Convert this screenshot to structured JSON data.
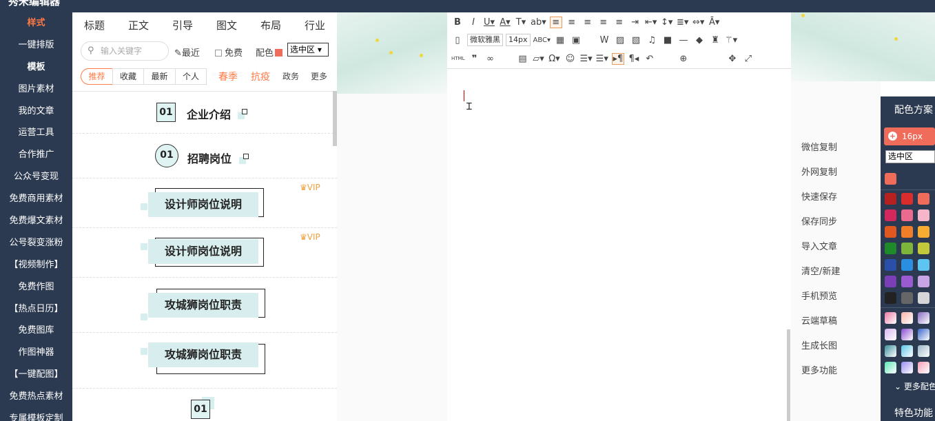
{
  "app": {
    "logo": "秀米编辑器"
  },
  "sidebar": {
    "items": [
      "样式",
      "一键排版",
      "模板",
      "图片素材",
      "我的文章",
      "运营工具",
      "合作推广",
      "公众号变现",
      "免费商用素材",
      "免费爆文素材",
      "公号裂变涨粉",
      "【视频制作】",
      "免费作图",
      "【热点日历】",
      "免费图库",
      "作图神器",
      "【一键配图】",
      "免费热点素材",
      "专属模板定制"
    ]
  },
  "panel": {
    "categories": [
      "标题",
      "正文",
      "引导",
      "图文",
      "布局",
      "行业"
    ],
    "search": {
      "placeholder": "输入关键字"
    },
    "recent": "最近",
    "free": "免费",
    "color_label": "配色",
    "color_select": "选中区 ▾",
    "filters": [
      "推荐",
      "收藏",
      "最新",
      "个人"
    ],
    "tags_hot": [
      "春季",
      "抗疫"
    ],
    "tags": [
      "政务",
      "更多"
    ],
    "templates": [
      {
        "num": "01",
        "title": "企业介绍"
      },
      {
        "num": "01",
        "title": "招聘岗位"
      },
      {
        "title": "设计师岗位说明",
        "badge": "VIP"
      },
      {
        "title": "设计师岗位说明",
        "badge": "VIP"
      },
      {
        "title": "攻城狮岗位职责"
      },
      {
        "title": "攻城狮岗位职责"
      },
      {
        "num": "01"
      }
    ]
  },
  "toolbar": {
    "font_family": "微软雅黑",
    "font_size": "14px",
    "html_label": "HTML"
  },
  "right_functions": [
    "微信复制",
    "外网复制",
    "快速保存",
    "保存同步",
    "导入文章",
    "清空/新建",
    "手机预览",
    "云端草稿",
    "生成长图",
    "更多功能"
  ],
  "color_panel": {
    "title": "配色方案",
    "size": "16px",
    "scope": "选中区",
    "current_color": "#ef6b5a",
    "more": "更多配色",
    "feature": "特色功能",
    "swatches": [
      [
        "#b52121",
        "#d92d2d",
        "#ef6b5a"
      ],
      [
        "#d2285d",
        "#ea6a90",
        "#f4b6c8"
      ],
      [
        "#e0581f",
        "#f07d2a",
        "#f6ad32"
      ],
      [
        "#1e8a2a",
        "#7db43c",
        "#c4c93a"
      ],
      [
        "#2a4fa8",
        "#2a8fe0",
        "#5ec5f2"
      ],
      [
        "#7a3fb6",
        "#9a5ad0",
        "#c8a6e6"
      ],
      [
        "#222222",
        "#666666",
        "#d6d6d6"
      ]
    ],
    "gradients": [
      [
        "#e97aa6",
        "#f5b4a8",
        "#8a6ec4"
      ],
      [
        "#d8b8f0",
        "#8a4bd0",
        "#3a66c8"
      ],
      [
        "#3b8e9a",
        "#5cc4e6",
        "#9ab6c8"
      ],
      [
        "#5ee6b6",
        "#9a8ef0",
        "#f4a0b8"
      ]
    ]
  }
}
